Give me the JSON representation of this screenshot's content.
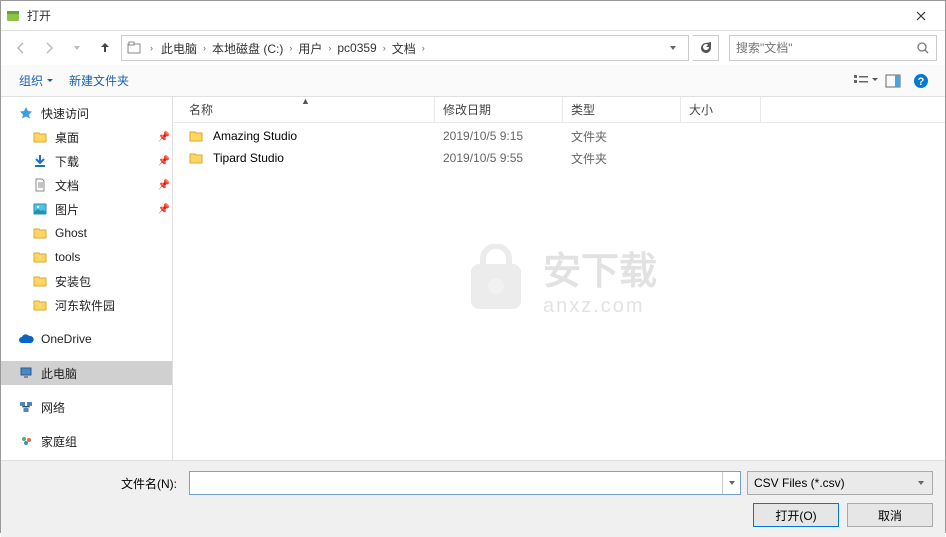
{
  "title": "打开",
  "breadcrumb": [
    "此电脑",
    "本地磁盘 (C:)",
    "用户",
    "pc0359",
    "文档"
  ],
  "search_placeholder": "搜索\"文档\"",
  "toolbar": {
    "organize": "组织",
    "new_folder": "新建文件夹"
  },
  "sidebar": {
    "quick": "快速访问",
    "desktop": "桌面",
    "downloads": "下载",
    "documents": "文档",
    "pictures": "图片",
    "ghost": "Ghost",
    "tools": "tools",
    "install_pkg": "安装包",
    "hedong": "河东软件园",
    "onedrive": "OneDrive",
    "this_pc": "此电脑",
    "network": "网络",
    "homegroup": "家庭组"
  },
  "columns": {
    "name": "名称",
    "date": "修改日期",
    "type": "类型",
    "size": "大小"
  },
  "rows": [
    {
      "name": "Amazing Studio",
      "date": "2019/10/5 9:15",
      "type": "文件夹"
    },
    {
      "name": "Tipard Studio",
      "date": "2019/10/5 9:55",
      "type": "文件夹"
    }
  ],
  "filename_label": "文件名(N):",
  "filter": "CSV Files (*.csv)",
  "buttons": {
    "open": "打开(O)",
    "cancel": "取消"
  },
  "watermark": {
    "main": "安下载",
    "sub": "anxz.com"
  }
}
